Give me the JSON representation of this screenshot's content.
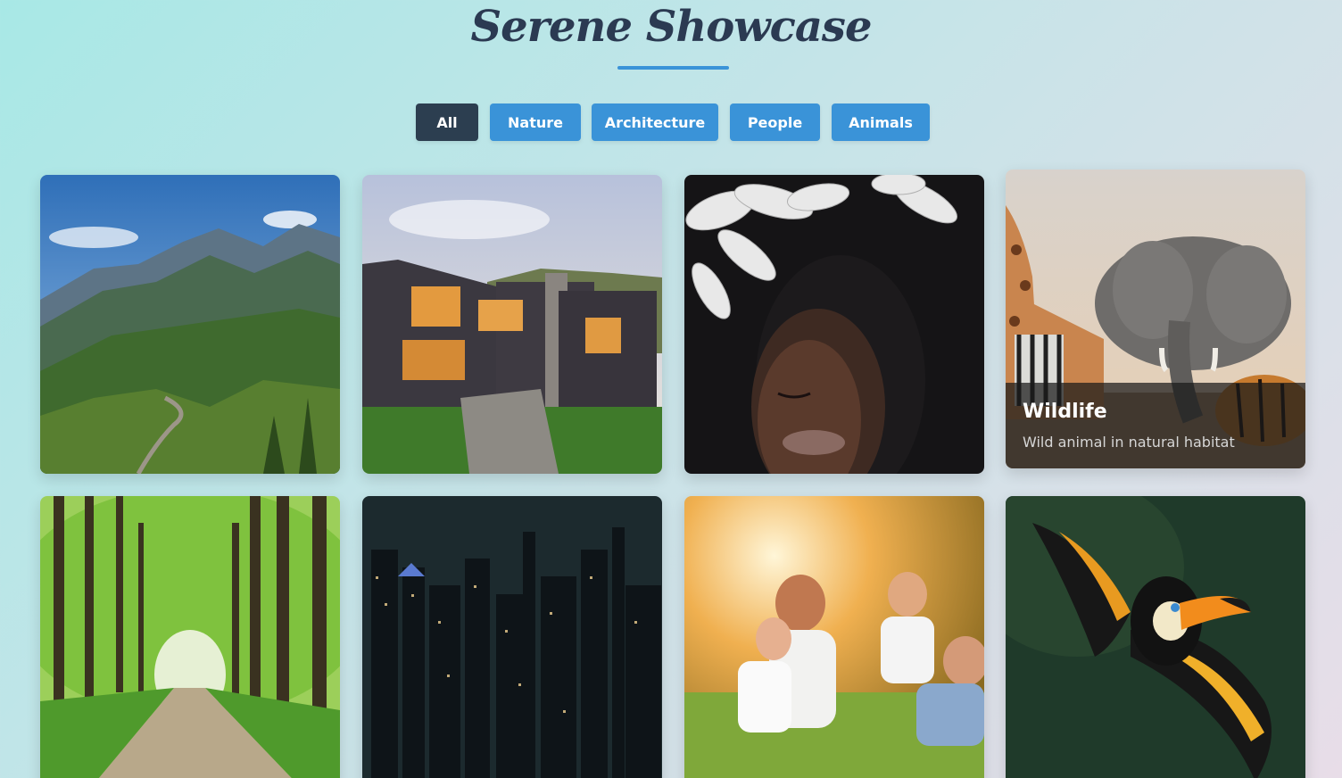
{
  "header": {
    "title": "Serene Showcase"
  },
  "filters": [
    {
      "label": "All",
      "active": true
    },
    {
      "label": "Nature",
      "active": false
    },
    {
      "label": "Architecture",
      "active": false
    },
    {
      "label": "People",
      "active": false
    },
    {
      "label": "Animals",
      "active": false
    }
  ],
  "gallery": {
    "hovered_item": {
      "title": "Wildlife",
      "description": "Wild animal in natural habitat"
    }
  },
  "colors": {
    "accent": "#3a93d8",
    "active_filter": "#2c3e50",
    "title": "#2b3a52"
  }
}
